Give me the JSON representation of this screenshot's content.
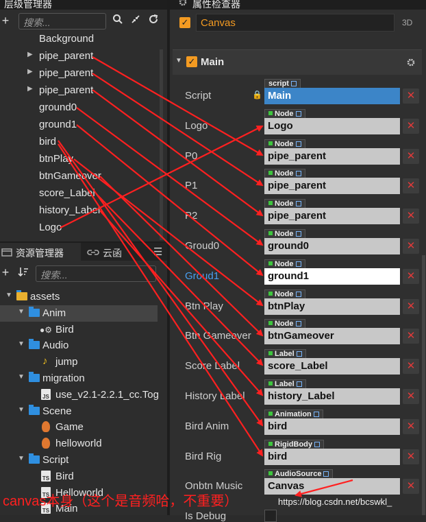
{
  "hierarchy": {
    "title": "层级管理器",
    "search_placeholder": "搜索...",
    "items": [
      {
        "label": "Background",
        "expandable": false
      },
      {
        "label": "pipe_parent",
        "expandable": true
      },
      {
        "label": "pipe_parent",
        "expandable": true
      },
      {
        "label": "pipe_parent",
        "expandable": true
      },
      {
        "label": "ground0",
        "expandable": false
      },
      {
        "label": "ground1",
        "expandable": false
      },
      {
        "label": "bird",
        "expandable": false
      },
      {
        "label": "btnPlay",
        "expandable": false
      },
      {
        "label": "btnGameover",
        "expandable": false
      },
      {
        "label": "score_Label",
        "expandable": false
      },
      {
        "label": "history_Label",
        "expandable": false
      },
      {
        "label": "Logo",
        "expandable": false
      }
    ]
  },
  "assets": {
    "tab_assets": "资源管理器",
    "tab_cloud": "云函",
    "search_placeholder": "搜索...",
    "items": [
      {
        "label": "assets",
        "kind": "root"
      },
      {
        "label": "Anim",
        "kind": "folder"
      },
      {
        "label": "Bird",
        "kind": "anim"
      },
      {
        "label": "Audio",
        "kind": "folder"
      },
      {
        "label": "jump",
        "kind": "audio"
      },
      {
        "label": "migration",
        "kind": "folder"
      },
      {
        "label": "use_v2.1-2.2.1_cc.Tog",
        "kind": "js",
        "badge": "JS"
      },
      {
        "label": "Scene",
        "kind": "folder"
      },
      {
        "label": "Game",
        "kind": "scene"
      },
      {
        "label": "helloworld",
        "kind": "scene"
      },
      {
        "label": "Script",
        "kind": "folder"
      },
      {
        "label": "Bird",
        "kind": "ts",
        "badge": "TS"
      },
      {
        "label": "Helloworld",
        "kind": "ts",
        "badge": "TS"
      },
      {
        "label": "Main",
        "kind": "ts",
        "badge": "TS"
      }
    ]
  },
  "inspector": {
    "title": "属性检查器",
    "node_name": "Canvas",
    "mode_3d": "3D",
    "component": "Main",
    "properties": [
      {
        "name": "Script",
        "tag": "script",
        "value": "Main",
        "style": "blue",
        "lock": true
      },
      {
        "name": "Logo",
        "tag": "Node",
        "value": "Logo"
      },
      {
        "name": "P0",
        "tag": "Node",
        "value": "pipe_parent"
      },
      {
        "name": "P1",
        "tag": "Node",
        "value": "pipe_parent"
      },
      {
        "name": "P2",
        "tag": "Node",
        "value": "pipe_parent"
      },
      {
        "name": "Groud0",
        "tag": "Node",
        "value": "ground0"
      },
      {
        "name": "Groud1",
        "tag": "Node",
        "value": "ground1",
        "style": "white",
        "highlight": true
      },
      {
        "name": "Btn Play",
        "tag": "Node",
        "value": "btnPlay"
      },
      {
        "name": "Btn Gameover",
        "tag": "Node",
        "value": "btnGameover"
      },
      {
        "name": "Score Label",
        "tag": "Label",
        "value": "score_Label"
      },
      {
        "name": "History Label",
        "tag": "Label",
        "value": "history_Label"
      },
      {
        "name": "Bird Anim",
        "tag": "Animation",
        "value": "bird"
      },
      {
        "name": "Bird Rig",
        "tag": "RigidBody",
        "value": "bird"
      },
      {
        "name": "Onbtn Music",
        "tag": "AudioSource",
        "value": "Canvas"
      },
      {
        "name": "Is Debug",
        "tag": "",
        "value": ""
      }
    ]
  },
  "annotation": {
    "text": "canvas本身（这个是音频哈，不重要）",
    "watermark": "https://blog.csdn.net/bcswkl_"
  },
  "colors": {
    "accent": "#f49b22",
    "arrow": "#ff2020",
    "field_blue": "#3c85c8",
    "remove_red": "#e03a3a",
    "folder_blue": "#2f8fe0"
  }
}
